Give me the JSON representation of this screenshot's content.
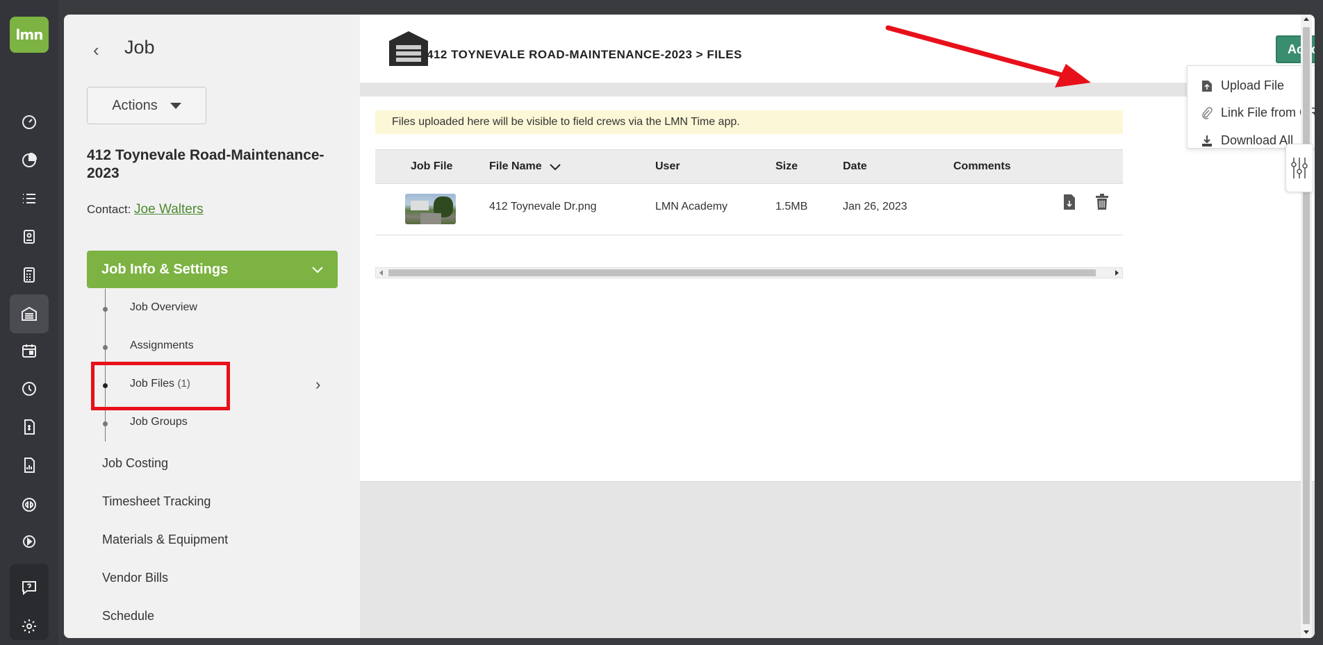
{
  "app": {
    "logo_text": "lmn",
    "colors": {
      "brand_green": "#7cb342",
      "action_green": "#3a8d6f",
      "rail": "#34353a",
      "annotation_red": "#e8101a"
    }
  },
  "rail": {
    "items": [
      {
        "icon": "dashboard-icon"
      },
      {
        "icon": "pie-chart-icon"
      },
      {
        "icon": "list-icon"
      },
      {
        "icon": "contact-card-icon"
      },
      {
        "icon": "calculator-icon"
      },
      {
        "icon": "garage-icon",
        "active": true
      },
      {
        "icon": "calendar-icon"
      },
      {
        "icon": "clock-icon"
      },
      {
        "icon": "invoice-icon"
      },
      {
        "icon": "report-icon"
      },
      {
        "icon": "quickbooks-icon"
      },
      {
        "icon": "play-circle-icon"
      },
      {
        "icon": "help-chat-icon"
      },
      {
        "icon": "gear-icon"
      }
    ]
  },
  "sidebar": {
    "title": "Job",
    "actions_label": "Actions",
    "job_name": "412 Toynevale Road-Maintenance-2023",
    "contact_label": "Contact:",
    "contact_name": "Joe Walters",
    "section_label": "Job Info & Settings",
    "sub_items": [
      {
        "label": "Job Overview",
        "count": ""
      },
      {
        "label": "Assignments",
        "count": ""
      },
      {
        "label": "Job Files",
        "count": "(1)"
      },
      {
        "label": "Job Groups",
        "count": ""
      }
    ],
    "links": [
      "Job Costing",
      "Timesheet Tracking",
      "Materials & Equipment",
      "Vendor Bills",
      "Schedule"
    ]
  },
  "header": {
    "breadcrumb": "412 TOYNEVALE ROAD-MAINTENANCE-2023 > FILES",
    "action_label": "Action"
  },
  "dropdown": {
    "items": [
      {
        "label": "Upload File",
        "icon": "upload-file-icon"
      },
      {
        "label": "Link File from CRM",
        "icon": "paperclip-icon"
      },
      {
        "label": "Download All",
        "icon": "download-icon"
      }
    ]
  },
  "notice": "Files uploaded here will be visible to field crews via the LMN Time app.",
  "table": {
    "columns": [
      "Job File",
      "File Name",
      "User",
      "Size",
      "Date",
      "Comments"
    ],
    "rows": [
      {
        "file_name": "412 Toynevale Dr.png",
        "user": "LMN Academy",
        "size": "1.5MB",
        "date": "Jan 26, 2023",
        "comments": ""
      }
    ]
  }
}
